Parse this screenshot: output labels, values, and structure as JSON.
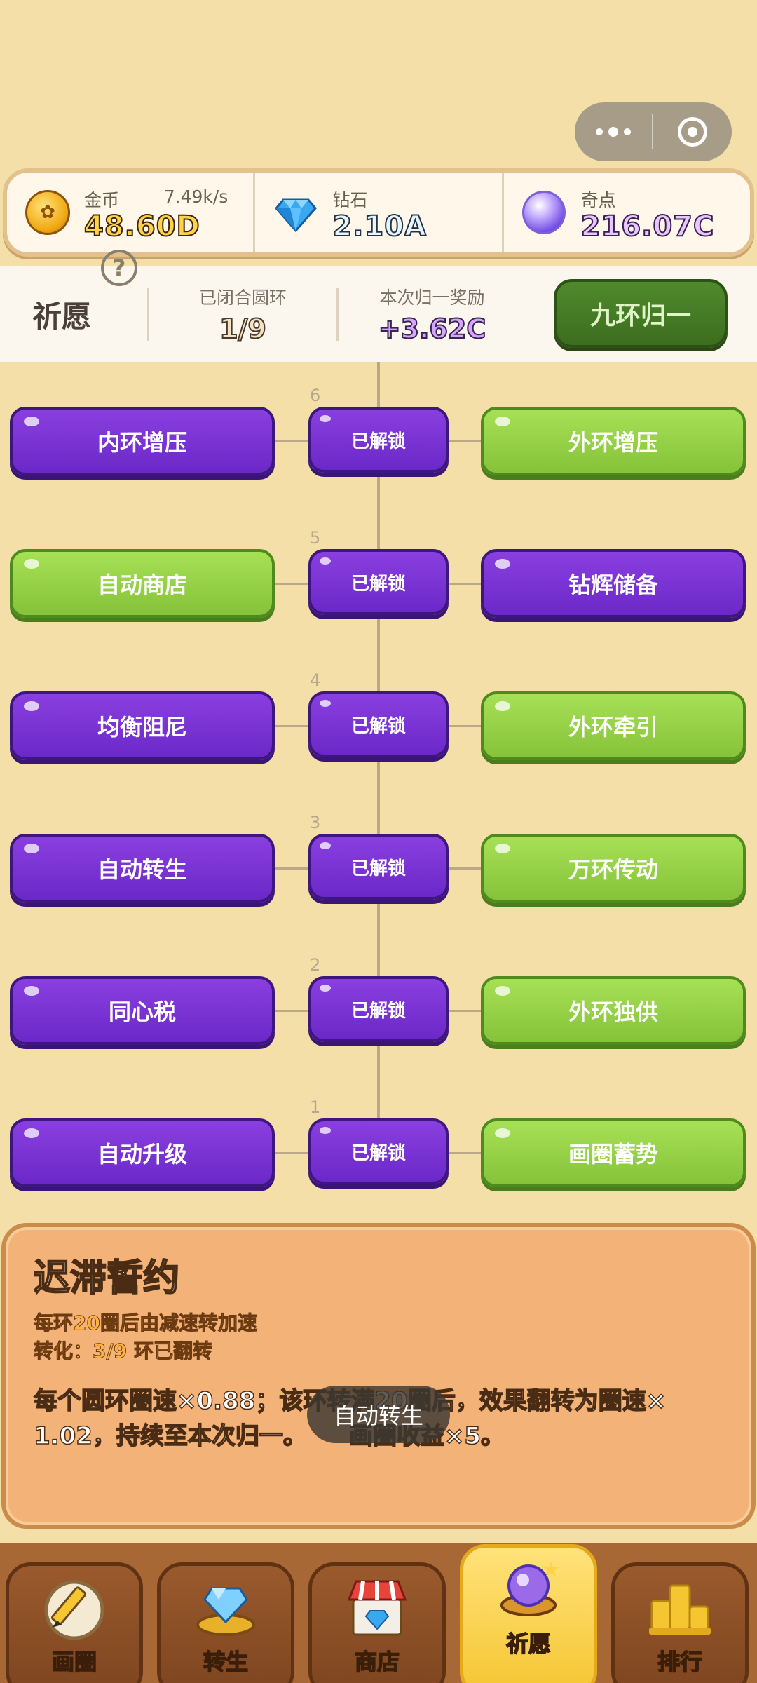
{
  "currencies": {
    "gold": {
      "label": "金币",
      "rate": "7.49k/s",
      "value": "48.60D",
      "icon": "gold-coin-icon"
    },
    "diamond": {
      "label": "钻石",
      "value": "2.10A",
      "icon": "diamond-icon"
    },
    "oddity": {
      "label": "奇点",
      "value": "216.07C",
      "icon": "purple-orb-icon"
    }
  },
  "prayer": {
    "title": "祈愿",
    "help": "?",
    "closed_rings_label": "已闭合圆环",
    "closed_rings_value": "1/9",
    "reward_label": "本次归一奖励",
    "reward_value": "+3.62C",
    "nine_ring_button": "九环归一"
  },
  "tree": {
    "rows": [
      {
        "level": "6",
        "left": "内环增压",
        "mid": "已解锁",
        "right": "外环增压",
        "left_color": "purple",
        "right_color": "green"
      },
      {
        "level": "5",
        "left": "自动商店",
        "mid": "已解锁",
        "right": "钻辉储备",
        "left_color": "green",
        "right_color": "purple"
      },
      {
        "level": "4",
        "left": "均衡阻尼",
        "mid": "已解锁",
        "right": "外环牵引",
        "left_color": "purple",
        "right_color": "green"
      },
      {
        "level": "3",
        "left": "自动转生",
        "mid": "已解锁",
        "right": "万环传动",
        "left_color": "purple",
        "right_color": "green"
      },
      {
        "level": "2",
        "left": "同心税",
        "mid": "已解锁",
        "right": "外环独供",
        "left_color": "purple",
        "right_color": "green"
      },
      {
        "level": "1",
        "left": "自动升级",
        "mid": "已解锁",
        "right": "画圈蓄势",
        "left_color": "purple",
        "right_color": "green"
      }
    ]
  },
  "description": {
    "title": "迟滞誓约",
    "line1": "每环20圈后由减速转加速",
    "line2": "转化：3/9 环已翻转",
    "body1": "每个圆环圈速×0.88；该环转满20圈后，效果翻转为圈速×",
    "body2": "1.02，持续至本次归一。",
    "body2_tail": "画圈收益×5。"
  },
  "toast": "自动转生",
  "nav": [
    {
      "label": "画圈",
      "icon": "pencil-icon",
      "active": false
    },
    {
      "label": "转生",
      "icon": "diamond-ring-icon",
      "active": false
    },
    {
      "label": "商店",
      "icon": "shop-icon",
      "active": false
    },
    {
      "label": "祈愿",
      "icon": "orb-icon",
      "active": true
    },
    {
      "label": "排行",
      "icon": "ranking-icon",
      "active": false
    }
  ],
  "colors": {
    "purple": "#7a33d6",
    "green": "#96d048",
    "background": "#f4dfa8"
  }
}
